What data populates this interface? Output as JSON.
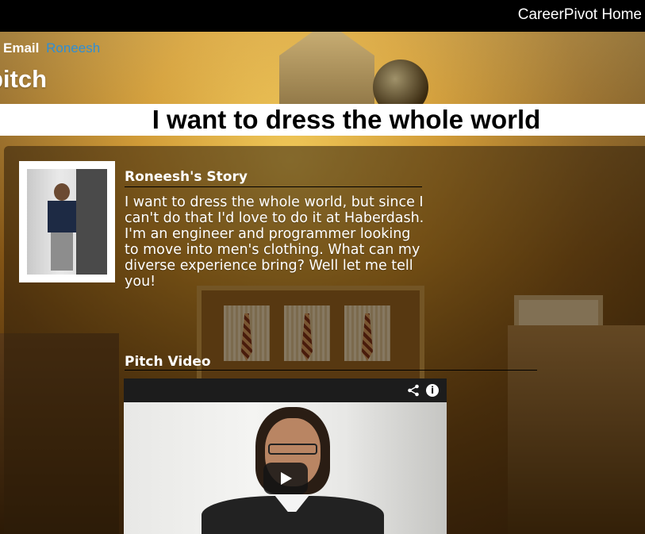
{
  "header": {
    "brand_link": "CareerPivot Home"
  },
  "contact": {
    "email_label": "Email",
    "email_name": "Roneesh"
  },
  "page": {
    "section_heading": "pitch",
    "headline": "I want to dress the whole world"
  },
  "story": {
    "title": "Roneesh's Story",
    "text": "I want to dress the whole world, but since I can't do that I'd love to do it at Haberdash. I'm an engineer and programmer looking to move into men's clothing. What can my diverse experience bring? Well let me tell you!"
  },
  "video": {
    "title": "Pitch Video",
    "info_glyph": "i",
    "icons": [
      "share-icon",
      "info-icon",
      "play-icon"
    ]
  },
  "colors": {
    "topbar": "#000000",
    "link": "#2e8fd6",
    "headline_band": "#ffffff"
  }
}
